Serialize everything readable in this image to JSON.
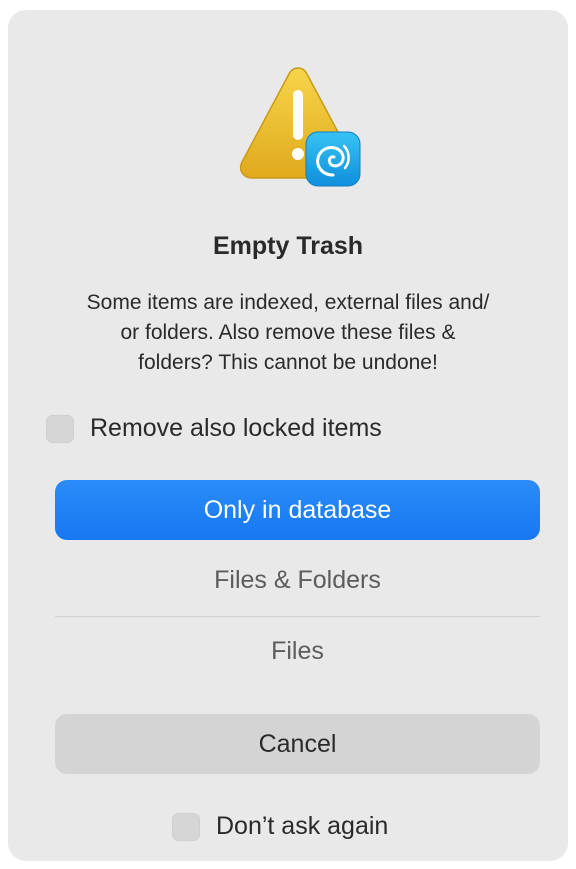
{
  "dialog": {
    "icon": "warning-triangle-icon",
    "badge_icon": "app-badge-shell-icon",
    "title": "Empty Trash",
    "message": "Some items are indexed, external files and/\nor folders. Also remove these files &\nfolders? This cannot be undone!",
    "locked_checkbox": {
      "label": "Remove also locked items",
      "checked": false
    },
    "buttons": {
      "primary": "Only in database",
      "files_folders": "Files & Folders",
      "files": "Files",
      "cancel": "Cancel"
    },
    "dont_ask_checkbox": {
      "label": "Don’t ask again",
      "checked": false
    }
  },
  "colors": {
    "dialog_background": "#e9e9e9",
    "primary_button": "#1677f2",
    "warning_yellow": "#f2c230",
    "badge_blue": "#1aa7e8"
  }
}
